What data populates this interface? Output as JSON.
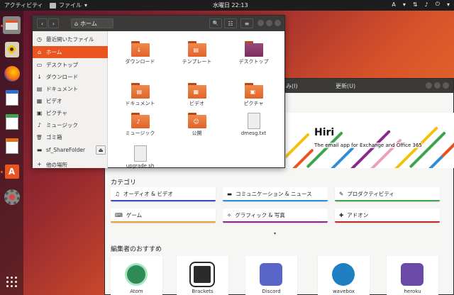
{
  "topbar": {
    "activities": "アクティビティ",
    "app_menu": "ファイル",
    "app_menu_arrow": "▾",
    "clock": "水曜日 22:13",
    "tray": [
      "A",
      "▾",
      "⇅",
      "♪",
      "⏻",
      "▾"
    ]
  },
  "dock": {
    "items": [
      "files-icon",
      "rhythmbox-icon",
      "firefox-icon",
      "writer-icon",
      "calc-icon",
      "impress-icon",
      "software-icon",
      "settings-icon"
    ],
    "show_apps": "show-apps-icon"
  },
  "files_window": {
    "back": "‹",
    "forward": "›",
    "path_label": "ホーム",
    "search_glyph": "🔍",
    "view_glyph": "☷",
    "menu_glyph": "≡",
    "sidebar": [
      {
        "label": "最近開いたファイル",
        "icon": "clock-icon",
        "glyph": "◷"
      },
      {
        "label": "ホーム",
        "icon": "home-icon",
        "glyph": "⌂",
        "active": true
      },
      {
        "label": "デスクトップ",
        "icon": "desktop-icon",
        "glyph": "▭"
      },
      {
        "label": "ダウンロード",
        "icon": "download-icon",
        "glyph": "↓"
      },
      {
        "label": "ドキュメント",
        "icon": "document-icon",
        "glyph": "▤"
      },
      {
        "label": "ビデオ",
        "icon": "video-icon",
        "glyph": "▦"
      },
      {
        "label": "ピクチャ",
        "icon": "picture-icon",
        "glyph": "▣"
      },
      {
        "label": "ミュージック",
        "icon": "music-icon",
        "glyph": "♪"
      },
      {
        "label": "ゴミ箱",
        "icon": "trash-icon",
        "glyph": "🗑"
      },
      {
        "label": "sf_ShareFolder",
        "icon": "drive-icon",
        "glyph": "▬"
      },
      {
        "label": "他の場所",
        "icon": "other-places-icon",
        "glyph": "+"
      }
    ],
    "eject_glyph": "⏏",
    "files": [
      {
        "label": "ダウンロード",
        "kind": "folder",
        "glyph": "↓"
      },
      {
        "label": "テンプレート",
        "kind": "folder",
        "glyph": "▤"
      },
      {
        "label": "デスクトップ",
        "kind": "folder-desktop",
        "glyph": ""
      },
      {
        "label": "ドキュメント",
        "kind": "folder",
        "glyph": "▤"
      },
      {
        "label": "ビデオ",
        "kind": "folder",
        "glyph": "▦"
      },
      {
        "label": "ピクチャ",
        "kind": "folder",
        "glyph": "▣"
      },
      {
        "label": "ミュージック",
        "kind": "folder",
        "glyph": "♪"
      },
      {
        "label": "公開",
        "kind": "folder",
        "glyph": "☺"
      },
      {
        "label": "dmesg.txt",
        "kind": "doc",
        "glyph": ""
      },
      {
        "label": "upgrade.sh",
        "kind": "doc",
        "glyph": ""
      }
    ]
  },
  "software_window": {
    "tab_left": "み(I)",
    "tab_right": "更新(U)",
    "banner": {
      "logo": "Hiri",
      "tagline": "The email app for Exchange and Office 365"
    },
    "categories_heading": "カテゴリ",
    "categories": [
      {
        "label": "オーディオ & ビデオ",
        "icon": "music-note-icon",
        "glyph": "♫",
        "color": "#3b4bb8"
      },
      {
        "label": "コミュニケーション & ニュース",
        "icon": "chat-icon",
        "glyph": "▬",
        "color": "#2e8dd6"
      },
      {
        "label": "プロダクティビティ",
        "icon": "edit-icon",
        "glyph": "✎",
        "color": "#3ca54e"
      },
      {
        "label": "ゲーム",
        "icon": "gamepad-icon",
        "glyph": "⌨",
        "color": "#e2a92b"
      },
      {
        "label": "グラフィック & 写真",
        "icon": "paint-icon",
        "glyph": "✧",
        "color": "#8b2a8e"
      },
      {
        "label": "アドオン",
        "icon": "puzzle-icon",
        "glyph": "✚",
        "color": "#c62828"
      }
    ],
    "caret": "▾",
    "editors_heading": "編集者のおすすめ",
    "apps": [
      {
        "name": "Atom",
        "icon": "atom-icon",
        "color": "#2e8b57"
      },
      {
        "name": "Brackets",
        "icon": "brackets-icon",
        "color": "#2b2b2b"
      },
      {
        "name": "Discord",
        "icon": "discord-icon",
        "color": "#5866c8"
      },
      {
        "name": "wavebox",
        "icon": "wavebox-icon",
        "color": "#1e7fc2"
      },
      {
        "name": "heroku",
        "icon": "heroku-icon",
        "color": "#6a49a8"
      }
    ]
  }
}
